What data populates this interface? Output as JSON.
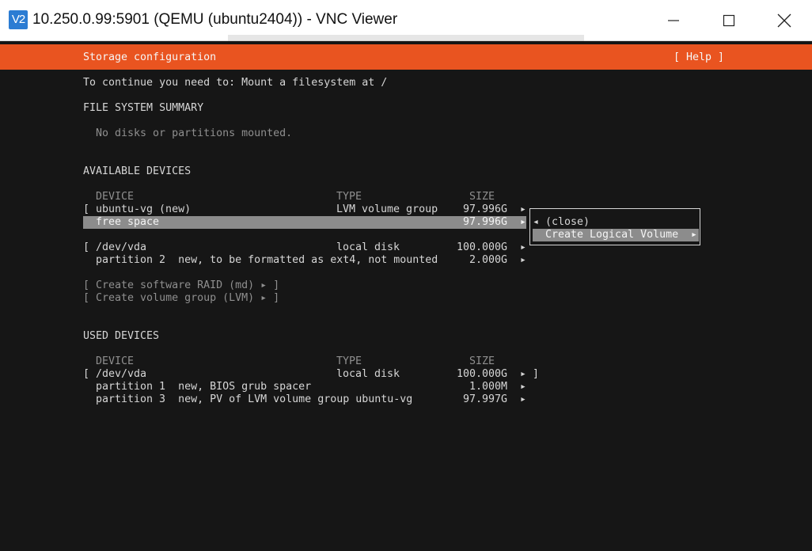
{
  "window": {
    "title": "10.250.0.99:5901 (QEMU (ubuntu2404)) - VNC Viewer",
    "icon_label": "V2",
    "controls": [
      "minimize-icon",
      "maximize-icon",
      "close-icon"
    ]
  },
  "colors": {
    "header": "#e95420",
    "background": "#161616",
    "text": "#d6d6d6",
    "dim_text": "#8f8f8f",
    "selection": "#8c8c8c",
    "vnc_icon": "#2b7cd3"
  },
  "header": {
    "title": "Storage configuration",
    "help": "[ Help ]"
  },
  "prompt": "To continue you need to: Mount a filesystem at /",
  "fs_summary": {
    "heading": "FILE SYSTEM SUMMARY",
    "empty": "No disks or partitions mounted."
  },
  "available": {
    "heading": "AVAILABLE DEVICES",
    "col_device": "DEVICE",
    "col_type": "TYPE",
    "col_size": "SIZE",
    "rows": [
      {
        "bracket": "[",
        "device": "ubuntu-vg (new)",
        "type": "LVM volume group",
        "size": "97.996G",
        "arrow": "▸"
      },
      {
        "bracket": "",
        "device": "free space",
        "type": "",
        "size": "97.996G",
        "arrow": "▸"
      },
      {
        "bracket": "[",
        "device": "/dev/vda",
        "type": "local disk",
        "size": "100.000G",
        "arrow": "▸"
      },
      {
        "bracket": "",
        "device": "partition 2  new, to be formatted as ext4, not mounted",
        "type": "",
        "size": "2.000G",
        "arrow": "▸"
      }
    ],
    "actions": [
      "[ Create software RAID (md) ▸ ]",
      "[ Create volume group (LVM) ▸ ]"
    ]
  },
  "used": {
    "heading": "USED DEVICES",
    "col_device": "DEVICE",
    "col_type": "TYPE",
    "col_size": "SIZE",
    "rows": [
      {
        "bracket": "[",
        "device": "/dev/vda",
        "type": "local disk",
        "size": "100.000G",
        "arrow": "▸ ]"
      },
      {
        "bracket": "",
        "device": "partition 1  new, BIOS grub spacer",
        "type": "",
        "size": "1.000M",
        "arrow": "▸"
      },
      {
        "bracket": "",
        "device": "partition 3  new, PV of LVM volume group ubuntu-vg",
        "type": "",
        "size": "97.997G",
        "arrow": "▸"
      }
    ]
  },
  "popup": {
    "close": "◂ (close)",
    "create": "Create Logical Volume",
    "create_arrow": "▸"
  }
}
